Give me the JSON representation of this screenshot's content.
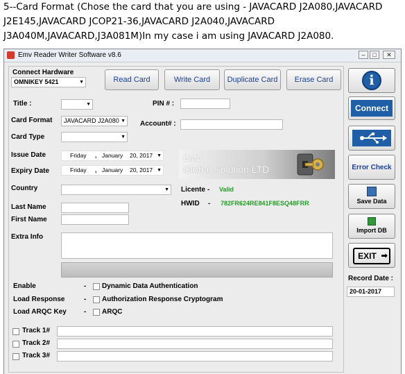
{
  "intro": {
    "text": "5--Card Format (Chose the card that you are using - JAVACARD J2A080,JAVACARD J2E145,JAVACARD JCOP21-36,JAVACARD J2A040,JAVACARD J3A040M,JAVACARD,J3A081M)In my case i am using  JAVACARD J2A080."
  },
  "window": {
    "title": "Emv Reader Writer Software v8.6",
    "controls": [
      "–",
      "□",
      "✕"
    ]
  },
  "hardware": {
    "label": "Connect Hardware",
    "value": "OMNIKEY 5421"
  },
  "toolbar": {
    "read": "Read Card",
    "write": "Write Card",
    "duplicate": "Duplicate Card",
    "erase": "Erase Card"
  },
  "form": {
    "title_label": "Title :",
    "title_value": "",
    "pin_label": "PIN # :",
    "pin_value": "",
    "card_format_label": "Card Format",
    "card_format_value": "JAVACARD J2A080",
    "account_label": "Account# :",
    "account_value": "",
    "card_type_label": "Card Type",
    "card_type_value": "",
    "issue_label": "Issue Date",
    "issue": {
      "day": "Friday",
      "sep": ",",
      "month": "January",
      "date": "20, 2017"
    },
    "expiry_label": "Expiry Date",
    "expiry": {
      "day": "Friday",
      "sep": ",",
      "month": "January",
      "date": "20, 2017"
    },
    "country_label": "Country",
    "country_value": "",
    "last_label": "Last Name",
    "last_value": "",
    "first_label": "First Name",
    "first_value": "",
    "extra_label": "Extra Info",
    "extra_value": ""
  },
  "logo": {
    "line1": "EMV",
    "line2": "Global Solution LTD"
  },
  "licence": {
    "label": "Licente",
    "dash": "-",
    "status": "Valid",
    "hwid_label": "HWID",
    "hwid_dash": "-",
    "hwid": "782FR624RE841F8ESQ48FRR"
  },
  "options": {
    "enable_label": "Enable",
    "enable_dash": "-",
    "enable_text": "Dynamic Data Authentication",
    "response_label": "Load Response",
    "response_dash": "-",
    "response_text": "Authorization Response Cryptogram",
    "arqc_label": "Load ARQC Key",
    "arqc_dash": "-",
    "arqc_text": "ARQC"
  },
  "tracks": {
    "t1": "Track 1#",
    "t2": "Track 2#",
    "t3": "Track 3#"
  },
  "side": {
    "info_glyph": "i",
    "connect": "Connect",
    "usb_icon": "usb-icon",
    "error": "Error Check",
    "save": "Save Data",
    "import": "Import DB",
    "exit": "EXIT"
  },
  "record": {
    "label": "Record Date :",
    "value": "20-01-2017"
  },
  "colors": {
    "accent": "#1e5fa8",
    "valid": "#20a020",
    "window_bg": "#ececec"
  }
}
